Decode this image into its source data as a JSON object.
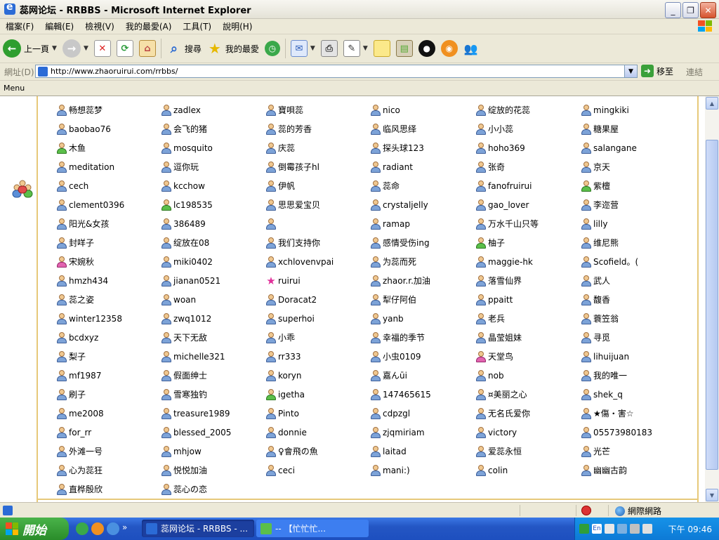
{
  "window": {
    "title": "蕊网论坛 - RRBBS - Microsoft Internet Explorer",
    "min": "_",
    "max": "❐",
    "close": "✕"
  },
  "menu": [
    "檔案(F)",
    "編輯(E)",
    "檢視(V)",
    "我的最愛(A)",
    "工具(T)",
    "說明(H)"
  ],
  "toolbar": {
    "back_label": "上一頁",
    "search_label": "搜尋",
    "favorites_label": "我的最愛"
  },
  "address": {
    "label": "網址(D)",
    "url": "http://www.zhaoruirui.com/rrbbs/",
    "go_label": "移至",
    "links_label": "連結"
  },
  "links_bar": {
    "menu_label": "Menu"
  },
  "users": [
    {
      "name": "畅想蕊梦",
      "icon": "user"
    },
    {
      "name": "zadlex",
      "icon": "user"
    },
    {
      "name": "寶唄蕊",
      "icon": "user"
    },
    {
      "name": "nico",
      "icon": "user"
    },
    {
      "name": "绽放的花蕊",
      "icon": "user"
    },
    {
      "name": "mingkiki",
      "icon": "user"
    },
    {
      "name": "baobao76",
      "icon": "user"
    },
    {
      "name": "会飞的猪",
      "icon": "user"
    },
    {
      "name": "蕊的芳香",
      "icon": "user"
    },
    {
      "name": "临风思绎",
      "icon": "user"
    },
    {
      "name": "小小蕊",
      "icon": "user"
    },
    {
      "name": "糖果屋",
      "icon": "user"
    },
    {
      "name": "木鱼",
      "icon": "green"
    },
    {
      "name": "mosquito",
      "icon": "user"
    },
    {
      "name": "庆蕊",
      "icon": "user"
    },
    {
      "name": "探头球123",
      "icon": "user"
    },
    {
      "name": "hoho369",
      "icon": "user"
    },
    {
      "name": "salangane",
      "icon": "user"
    },
    {
      "name": "meditation",
      "icon": "user"
    },
    {
      "name": "逗你玩",
      "icon": "user"
    },
    {
      "name": "倒霉孩子hl",
      "icon": "user"
    },
    {
      "name": "radiant",
      "icon": "user"
    },
    {
      "name": "张奇",
      "icon": "user"
    },
    {
      "name": "京天",
      "icon": "user"
    },
    {
      "name": "cech",
      "icon": "user"
    },
    {
      "name": "kcchow",
      "icon": "user"
    },
    {
      "name": "伊帆",
      "icon": "user"
    },
    {
      "name": "蕊命",
      "icon": "user"
    },
    {
      "name": "fanofruirui",
      "icon": "user"
    },
    {
      "name": "紫檀",
      "icon": "green"
    },
    {
      "name": "clement0396",
      "icon": "user"
    },
    {
      "name": "lc198535",
      "icon": "green"
    },
    {
      "name": "思思爱宝贝",
      "icon": "user"
    },
    {
      "name": "crystaljelly",
      "icon": "user"
    },
    {
      "name": "gao_lover",
      "icon": "user"
    },
    {
      "name": "李迩营",
      "icon": "user"
    },
    {
      "name": "阳光&女孩",
      "icon": "user"
    },
    {
      "name": "386489",
      "icon": "user"
    },
    {
      "name": "",
      "icon": "user"
    },
    {
      "name": "ramap",
      "icon": "user"
    },
    {
      "name": "万水千山只等",
      "icon": "user"
    },
    {
      "name": "lilly",
      "icon": "user"
    },
    {
      "name": "封咩子",
      "icon": "user"
    },
    {
      "name": "绽放在08",
      "icon": "user"
    },
    {
      "name": "我们支持你",
      "icon": "user"
    },
    {
      "name": "感情受伤ing",
      "icon": "user"
    },
    {
      "name": "柚子",
      "icon": "green"
    },
    {
      "name": "维尼熊",
      "icon": "user"
    },
    {
      "name": "宋婉秋",
      "icon": "pink"
    },
    {
      "name": "miki0402",
      "icon": "user"
    },
    {
      "name": "xchlovenvpai",
      "icon": "user"
    },
    {
      "name": "为蕊而死",
      "icon": "user"
    },
    {
      "name": "maggie-hk",
      "icon": "user"
    },
    {
      "name": "Scofield。(",
      "icon": "user"
    },
    {
      "name": "hmzh434",
      "icon": "user"
    },
    {
      "name": "jianan0521",
      "icon": "user"
    },
    {
      "name": "ruirui",
      "icon": "star"
    },
    {
      "name": "zhaor.r.加油",
      "icon": "user"
    },
    {
      "name": "落雪仙界",
      "icon": "user"
    },
    {
      "name": "武人",
      "icon": "user"
    },
    {
      "name": "蕊之姿",
      "icon": "user"
    },
    {
      "name": "woan",
      "icon": "user"
    },
    {
      "name": "Doracat2",
      "icon": "user"
    },
    {
      "name": "犁仔阿伯",
      "icon": "user"
    },
    {
      "name": "ppaitt",
      "icon": "user"
    },
    {
      "name": "馥香",
      "icon": "user"
    },
    {
      "name": "winter12358",
      "icon": "user"
    },
    {
      "name": "zwq1012",
      "icon": "user"
    },
    {
      "name": "superhoi",
      "icon": "user"
    },
    {
      "name": "yanb",
      "icon": "user"
    },
    {
      "name": "老兵",
      "icon": "user"
    },
    {
      "name": "蓑笠翁",
      "icon": "user"
    },
    {
      "name": "bcdxyz",
      "icon": "user"
    },
    {
      "name": "天下无敌",
      "icon": "user"
    },
    {
      "name": "小乖",
      "icon": "user"
    },
    {
      "name": "幸福的季节",
      "icon": "user"
    },
    {
      "name": "晶莹姐妹",
      "icon": "user"
    },
    {
      "name": "寻觅",
      "icon": "user"
    },
    {
      "name": "梨子",
      "icon": "user"
    },
    {
      "name": "michelle321",
      "icon": "user"
    },
    {
      "name": "rr333",
      "icon": "user"
    },
    {
      "name": "小虫0109",
      "icon": "user"
    },
    {
      "name": "天堂鸟",
      "icon": "pink"
    },
    {
      "name": "lihuijuan",
      "icon": "user"
    },
    {
      "name": "mf1987",
      "icon": "user"
    },
    {
      "name": "假面绅士",
      "icon": "user"
    },
    {
      "name": "koryn",
      "icon": "user"
    },
    {
      "name": "嘉んūi",
      "icon": "user"
    },
    {
      "name": "nob",
      "icon": "user"
    },
    {
      "name": "我的唯一",
      "icon": "user"
    },
    {
      "name": "刷子",
      "icon": "user"
    },
    {
      "name": "雪寒独钓",
      "icon": "user"
    },
    {
      "name": "igetha",
      "icon": "green"
    },
    {
      "name": "147465615",
      "icon": "user"
    },
    {
      "name": "¤美丽之心",
      "icon": "user"
    },
    {
      "name": "shek_q",
      "icon": "user"
    },
    {
      "name": "me2008",
      "icon": "user"
    },
    {
      "name": "treasure1989",
      "icon": "user"
    },
    {
      "name": "Pinto",
      "icon": "user"
    },
    {
      "name": "cdpzgl",
      "icon": "user"
    },
    {
      "name": "无名氏爱你",
      "icon": "user"
    },
    {
      "name": "★傷・害☆",
      "icon": "user"
    },
    {
      "name": "for_rr",
      "icon": "user"
    },
    {
      "name": "blessed_2005",
      "icon": "user"
    },
    {
      "name": "donnie",
      "icon": "user"
    },
    {
      "name": "zjqmiriam",
      "icon": "user"
    },
    {
      "name": "victory",
      "icon": "user"
    },
    {
      "name": "05573980183",
      "icon": "user"
    },
    {
      "name": "外滩一号",
      "icon": "user"
    },
    {
      "name": "mhjow",
      "icon": "user"
    },
    {
      "name": "♀會飛の魚",
      "icon": "user"
    },
    {
      "name": "laitad",
      "icon": "user"
    },
    {
      "name": "爱蕊永恒",
      "icon": "user"
    },
    {
      "name": "光芒",
      "icon": "user"
    },
    {
      "name": "心为蕊狂",
      "icon": "user"
    },
    {
      "name": "悦悦加油",
      "icon": "user"
    },
    {
      "name": "ceci",
      "icon": "user"
    },
    {
      "name": "mani:)",
      "icon": "user"
    },
    {
      "name": "colin",
      "icon": "user"
    },
    {
      "name": "幽幽古韵",
      "icon": "user"
    },
    {
      "name": "直桦殷欣",
      "icon": "user"
    },
    {
      "name": "蕊心の恋",
      "icon": "user"
    }
  ],
  "status": {
    "zone_label": "網際網路"
  },
  "taskbar": {
    "start_label": "開始",
    "chevron": "»",
    "tasks": [
      {
        "label": "蕊网论坛 - RRBBS - ...",
        "active": true
      },
      {
        "label": "-- 【忙忙忙...",
        "active": false
      }
    ],
    "clock": "下午 09:46"
  },
  "colors": {
    "xp_blue": "#2456c4",
    "start_green": "#2a8c2a",
    "frame_gold": "#e7c97a"
  }
}
